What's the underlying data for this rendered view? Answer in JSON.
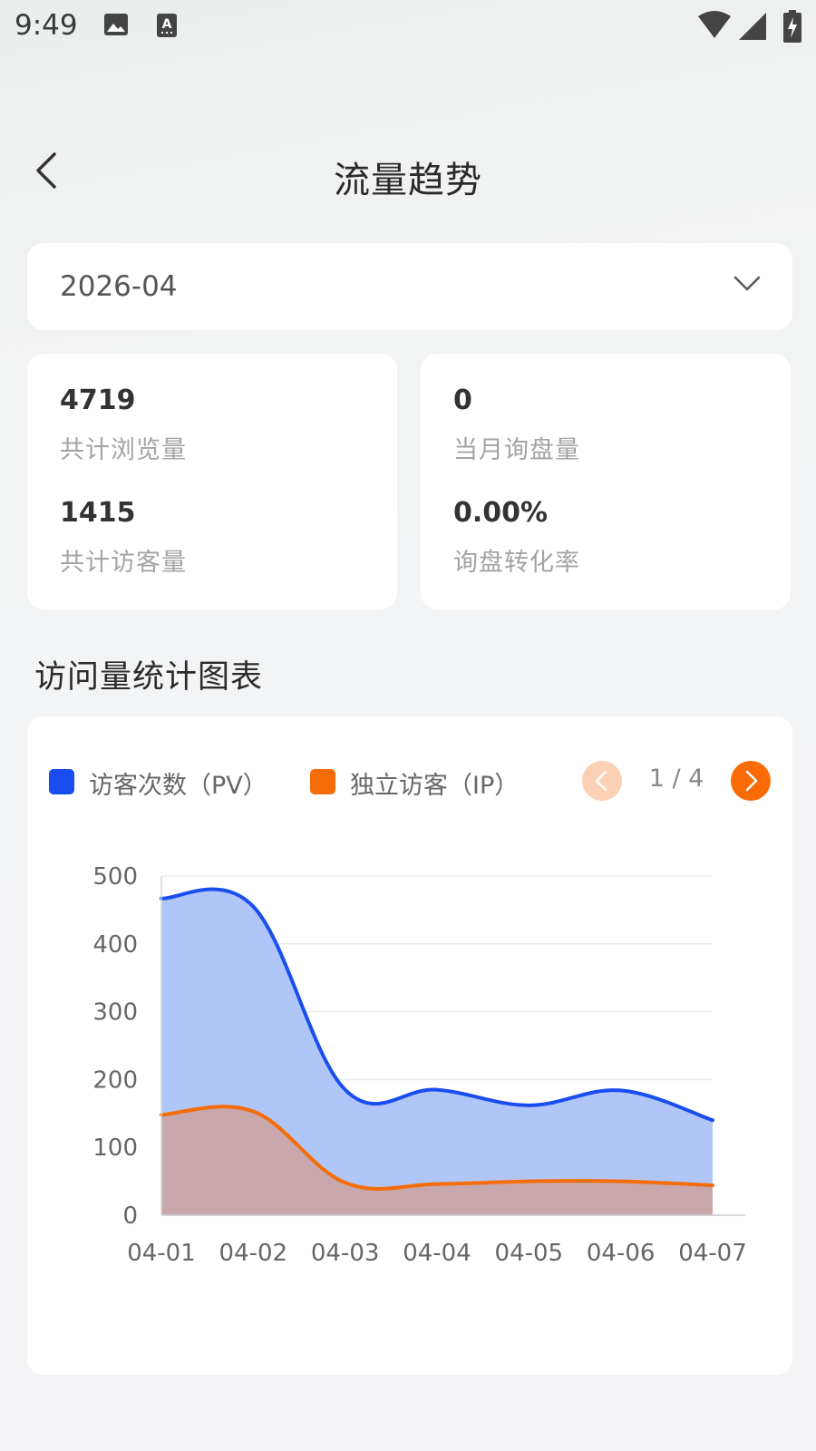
{
  "status_bar": {
    "time": "9:49"
  },
  "header": {
    "title": "流量趋势"
  },
  "month_select": {
    "value": "2026-04"
  },
  "stats": {
    "total_pv": {
      "value": "4719",
      "label": "共计浏览量"
    },
    "monthly_inquiries": {
      "value": "0",
      "label": "当月询盘量"
    },
    "total_visitors": {
      "value": "1415",
      "label": "共计访客量"
    },
    "conversion_rate": {
      "value": "0.00%",
      "label": "询盘转化率"
    }
  },
  "section": {
    "title": "访问量统计图表"
  },
  "legend": {
    "pv": "访客次数（PV）",
    "ip": "独立访客（IP）"
  },
  "pager": {
    "text": "1 / 4"
  },
  "colors": {
    "pv": "#1a4df0",
    "pv_fill": "#a9c0f7",
    "ip": "#f56c08",
    "ip_fill": "#c9a6a8",
    "accent": "#fa6b06"
  },
  "chart_data": {
    "type": "area",
    "categories": [
      "04-01",
      "04-02",
      "04-03",
      "04-04",
      "04-05",
      "04-06",
      "04-07"
    ],
    "series": [
      {
        "name": "访客次数（PV）",
        "values": [
          467,
          455,
          185,
          185,
          162,
          184,
          140
        ]
      },
      {
        "name": "独立访客（IP）",
        "values": [
          148,
          153,
          48,
          46,
          50,
          50,
          44
        ]
      }
    ],
    "yticks": [
      0,
      100,
      200,
      300,
      400,
      500
    ],
    "ylim": [
      0,
      500
    ],
    "grid": true,
    "legend_position": "top-left"
  }
}
